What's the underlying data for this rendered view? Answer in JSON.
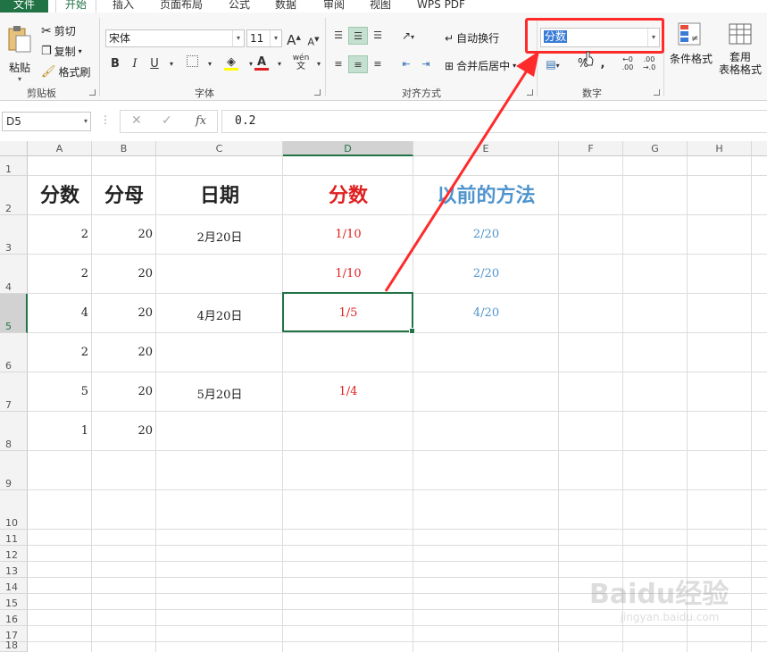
{
  "tabs": [
    "文件",
    "开始",
    "插入",
    "页面布局",
    "公式",
    "数据",
    "审阅",
    "视图",
    "WPS PDF"
  ],
  "ribbon": {
    "clipboard": {
      "paste": "粘贴",
      "cut": "剪切",
      "copy": "复制",
      "format_painter": "格式刷",
      "label": "剪贴板"
    },
    "font": {
      "name": "宋体",
      "size": "11",
      "grow": "A",
      "shrink": "A",
      "bold": "B",
      "italic": "I",
      "underline": "U",
      "phonetic": "wén",
      "label": "字体"
    },
    "alignment": {
      "wrap_text": "自动换行",
      "merge_center": "合并后居中",
      "label": "对齐方式"
    },
    "number": {
      "format": "分数",
      "percent": "%",
      "comma": ",",
      "label": "数字"
    },
    "styles": {
      "conditional": "条件格式",
      "table_format_1": "套用",
      "table_format_2": "表格格式"
    }
  },
  "formula_bar": {
    "name_box": "D5",
    "fx": "fx",
    "value": "0.2"
  },
  "columns": [
    "A",
    "B",
    "C",
    "D",
    "E",
    "F",
    "G",
    "H"
  ],
  "rows": [
    "1",
    "2",
    "3",
    "4",
    "5",
    "6",
    "7",
    "8",
    "9",
    "10",
    "11",
    "12",
    "13",
    "14",
    "15",
    "16",
    "17",
    "18"
  ],
  "selected_cell": "D5",
  "cells": {
    "headers": {
      "a": "分数",
      "b": "分母",
      "c": "日期",
      "d": "分数",
      "e": "以前的方法"
    },
    "r3": {
      "a": "2",
      "b": "20",
      "c": "2月20日",
      "d": "1/10",
      "e": "2/20"
    },
    "r4": {
      "a": "2",
      "b": "20",
      "c": "",
      "d": "1/10",
      "e": "2/20"
    },
    "r5": {
      "a": "4",
      "b": "20",
      "c": "4月20日",
      "d": "1/5",
      "e": "4/20"
    },
    "r6": {
      "a": "2",
      "b": "20",
      "c": "",
      "d": "",
      "e": ""
    },
    "r7": {
      "a": "5",
      "b": "20",
      "c": "5月20日",
      "d": "1/4",
      "e": ""
    },
    "r8": {
      "a": "1",
      "b": "20",
      "c": "",
      "d": "",
      "e": ""
    }
  },
  "colors": {
    "accent": "#217346",
    "red_text": "#e02020",
    "blue_text": "#4f94cd",
    "annotation": "#ff2a2a"
  },
  "watermark": {
    "brand": "Baidu经验",
    "url": "jingyan.baidu.com"
  }
}
